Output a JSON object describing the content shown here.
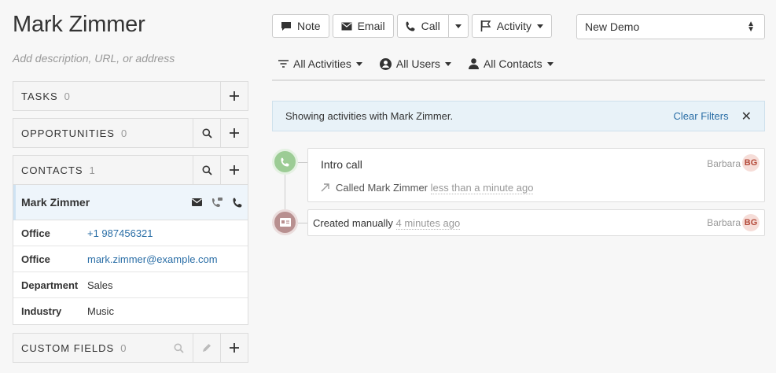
{
  "contact": {
    "name": "Mark Zimmer",
    "description_placeholder": "Add description, URL, or address"
  },
  "panels": {
    "tasks": {
      "label": "TASKS",
      "count": "0"
    },
    "opportunities": {
      "label": "OPPORTUNITIES",
      "count": "0"
    },
    "contacts": {
      "label": "CONTACTS",
      "count": "1"
    },
    "custom_fields": {
      "label": "CUSTOM FIELDS",
      "count": "0"
    }
  },
  "contact_card": {
    "name": "Mark Zimmer",
    "rows": [
      {
        "label": "Office",
        "value": "+1 987456321"
      },
      {
        "label": "Office",
        "value": "mark.zimmer@example.com"
      },
      {
        "label": "Department",
        "value": "Sales"
      },
      {
        "label": "Industry",
        "value": "Music"
      }
    ]
  },
  "toolbar": {
    "note": "Note",
    "email": "Email",
    "call": "Call",
    "activity": "Activity"
  },
  "pipeline_select": {
    "value": "New Demo"
  },
  "filters": {
    "activities": "All Activities",
    "users": "All Users",
    "contacts": "All Contacts"
  },
  "banner": {
    "text": "Showing activities with Mark Zimmer.",
    "clear": "Clear Filters"
  },
  "timeline": [
    {
      "title": "Intro call",
      "detail": "Called Mark Zimmer",
      "ago": "less than a minute ago",
      "user": "Barbara",
      "initials": "BG"
    },
    {
      "title": "Created manually",
      "ago": "4 minutes ago",
      "user": "Barbara",
      "initials": "BG"
    }
  ],
  "colors": {
    "link": "#2a6ea6",
    "call_dot": "#9ccc95",
    "created_dot": "#b89090",
    "badge_bg": "#f6ddd8",
    "badge_text": "#b44a3a",
    "banner_bg": "#e8f2f8"
  }
}
